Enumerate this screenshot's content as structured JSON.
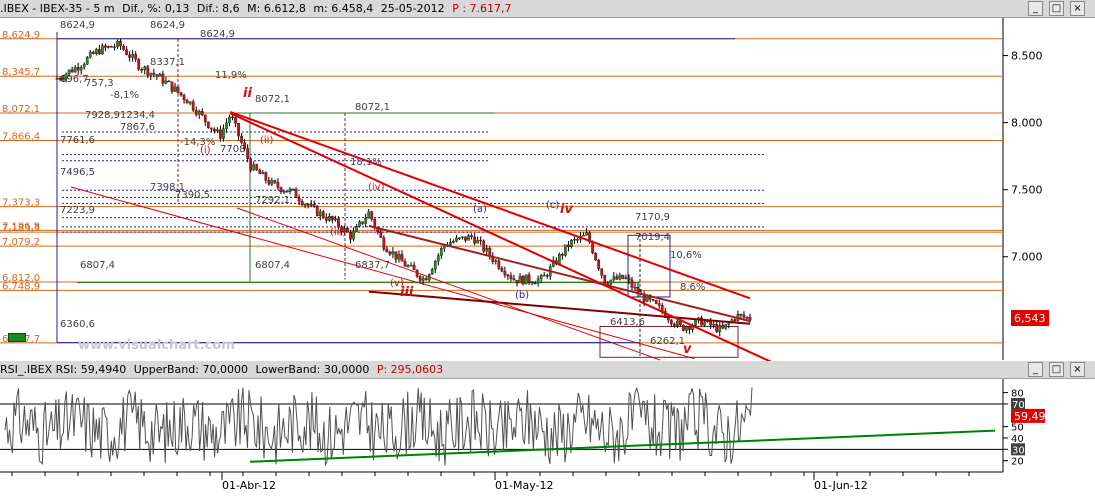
{
  "main_header": {
    "symbol": ".IBEX - IBEX-35 - 5 m",
    "dif": "Dif., %: 0,13",
    "dif2": "Dif.: 8,6",
    "max": "M: 6.612,8",
    "min": "m: 6.458,4",
    "date": "25-05-2012",
    "p": "P : 7.617,7"
  },
  "rsi_header": {
    "label": "RSI_.IBEX RSI: 59,4940",
    "upper": "UpperBand: 70,0000",
    "lower": "LowerBand: 30,0000",
    "p": "P: 295,0603"
  },
  "watermark": "www.visualchart.com",
  "colors": {
    "bg": "#ffffff",
    "price_hline": "#d2691e",
    "trend": "#e00000",
    "support": "#800000",
    "fib": "#404040",
    "up": "#2a8c2a",
    "down": "#d01010",
    "rsi_line": "#505050",
    "rsi_trend": "#008000",
    "tag": "#d01010"
  },
  "chart_data": [
    {
      "type": "candlestick",
      "title": "",
      "y_axis_ticks": [
        "8.500",
        "8.000",
        "7.500",
        "7.000"
      ],
      "ylim": [
        6230,
        8780
      ],
      "x_ticks": [
        "01-Abr-12",
        "01-May-12",
        "01-Jun-12"
      ],
      "last_price_tag": "6,543",
      "left_price_labels": [
        "8,624,9",
        "8,345,7",
        "8,072,1",
        "7,866,4",
        "7,373,3",
        "7,196,8",
        "7,183,3",
        "7,079,2",
        "6,812,0",
        "6,748,9",
        "6,357,7"
      ],
      "left_price_values": [
        8624.9,
        8345.7,
        8072.1,
        7866.4,
        7373.3,
        7196.8,
        7183.3,
        7079.2,
        6812.0,
        6748.9,
        6357.7
      ],
      "path_points": [
        [
          0,
          8330
        ],
        [
          0.03,
          8420
        ],
        [
          0.06,
          8540
        ],
        [
          0.09,
          8580
        ],
        [
          0.12,
          8420
        ],
        [
          0.15,
          8330
        ],
        [
          0.19,
          8160
        ],
        [
          0.22,
          7980
        ],
        [
          0.235,
          7900
        ],
        [
          0.25,
          8060
        ],
        [
          0.28,
          7670
        ],
        [
          0.31,
          7540
        ],
        [
          0.34,
          7480
        ],
        [
          0.37,
          7350
        ],
        [
          0.4,
          7260
        ],
        [
          0.425,
          7150
        ],
        [
          0.45,
          7330
        ],
        [
          0.47,
          7100
        ],
        [
          0.5,
          6950
        ],
        [
          0.53,
          6830
        ],
        [
          0.56,
          7100
        ],
        [
          0.6,
          7150
        ],
        [
          0.63,
          6980
        ],
        [
          0.66,
          6830
        ],
        [
          0.7,
          6830
        ],
        [
          0.74,
          7100
        ],
        [
          0.765,
          7160
        ],
        [
          0.79,
          6820
        ],
        [
          0.82,
          6840
        ],
        [
          0.84,
          6720
        ],
        [
          0.87,
          6610
        ],
        [
          0.9,
          6470
        ],
        [
          0.93,
          6520
        ],
        [
          0.96,
          6450
        ],
        [
          0.98,
          6560
        ],
        [
          1.0,
          6540
        ]
      ],
      "trendlines": [
        {
          "name": "upper-channel",
          "from": [
            0.25,
            8080
          ],
          "to": [
            1.0,
            6690
          ]
        },
        {
          "name": "lower-channel",
          "from": [
            0.02,
            7520
          ],
          "to": [
            0.92,
            6240
          ]
        },
        {
          "name": "wedge-top",
          "from": [
            0.45,
            7230
          ],
          "to": [
            1.0,
            6520
          ]
        },
        {
          "name": "support",
          "from": [
            0.45,
            6740
          ],
          "to": [
            1.0,
            6500
          ]
        },
        {
          "name": "main-downtrend",
          "from": [
            0.25,
            8070
          ],
          "to": [
            1.05,
            6170
          ]
        }
      ],
      "annotations": [
        {
          "text": "ii",
          "kind": "wave"
        },
        {
          "text": "iii",
          "kind": "wave"
        },
        {
          "text": "iv",
          "kind": "wave"
        },
        {
          "text": "v",
          "kind": "wave"
        },
        {
          "text": "(i)",
          "kind": "sub"
        },
        {
          "text": "(ii)",
          "kind": "sub"
        },
        {
          "text": "(iii)",
          "kind": "sub"
        },
        {
          "text": "(iv)",
          "kind": "sub"
        },
        {
          "text": "(v)",
          "kind": "sub"
        },
        {
          "text": "(a)",
          "kind": "abc"
        },
        {
          "text": "(b)",
          "kind": "abc"
        },
        {
          "text": "(c)",
          "kind": "abc"
        },
        {
          "text": "8624,9",
          "kind": "fib"
        },
        {
          "text": "8072,1",
          "kind": "fib"
        },
        {
          "text": "7761,6",
          "kind": "fib"
        },
        {
          "text": "7716,1",
          "kind": "fib"
        },
        {
          "text": "7496,5",
          "kind": "fib"
        },
        {
          "text": "7443,1",
          "kind": "fib"
        },
        {
          "text": "7398,1",
          "kind": "fib"
        },
        {
          "text": "7390,5",
          "kind": "fib"
        },
        {
          "text": "7292,1",
          "kind": "fib"
        },
        {
          "text": "7223,9",
          "kind": "fib"
        },
        {
          "text": "7170,9",
          "kind": "fib"
        },
        {
          "text": "7019,4",
          "kind": "fib"
        },
        {
          "text": "6807,4",
          "kind": "fib"
        },
        {
          "text": "6837,7",
          "kind": "fib"
        },
        {
          "text": "6413,6",
          "kind": "fib"
        },
        {
          "text": "6360,6",
          "kind": "fib"
        },
        {
          "text": "6262,1",
          "kind": "fib"
        },
        {
          "text": "11,9%",
          "kind": "pct"
        },
        {
          "text": "18,1%",
          "kind": "pct"
        },
        {
          "text": "-14,3%",
          "kind": "pct"
        },
        {
          "text": "-8,1%",
          "kind": "pct"
        },
        {
          "text": "10,6%",
          "kind": "pct"
        },
        {
          "text": "8,6%",
          "kind": "pct"
        },
        {
          "text": "696,7",
          "kind": "fib"
        },
        {
          "text": "757,3",
          "kind": "fib"
        },
        {
          "text": "1234,4",
          "kind": "fib"
        },
        {
          "text": "7928,9",
          "kind": "fib"
        },
        {
          "text": "7867,6",
          "kind": "fib"
        },
        {
          "text": "7708",
          "kind": "fib"
        },
        {
          "text": "8337,1",
          "kind": "fib"
        }
      ]
    },
    {
      "type": "line",
      "title": "",
      "y_axis_ticks": [
        "80",
        "70",
        "50",
        "40",
        "30",
        "20"
      ],
      "ylim": [
        10,
        92
      ],
      "upper_band": 70,
      "lower_band": 30,
      "last_value_tag": "59,49",
      "band_tags": [
        "70",
        "30"
      ],
      "trendline": {
        "from": [
          0.24,
          19
        ],
        "to": [
          1.0,
          47
        ]
      }
    }
  ]
}
